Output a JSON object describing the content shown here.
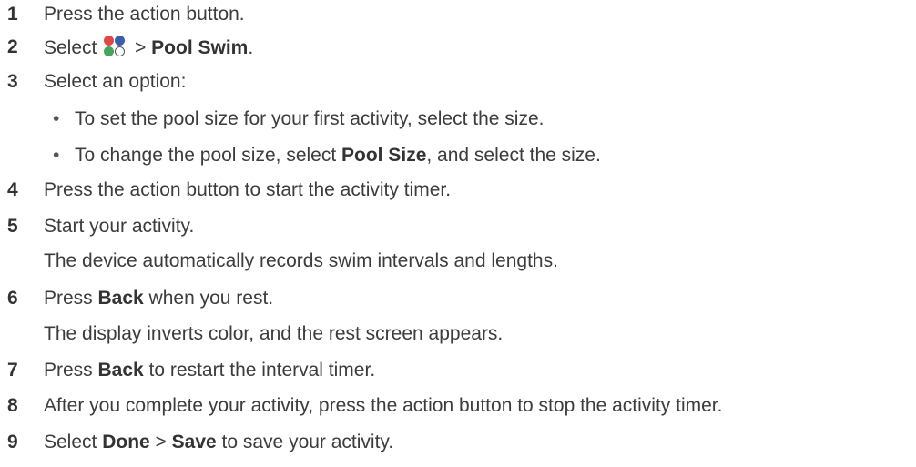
{
  "steps": [
    {
      "num": "1",
      "text": "Press the action button."
    },
    {
      "num": "2",
      "pre": "Select",
      "icon": "activity-colors-icon",
      "sep": " > ",
      "bold": "Pool Swim",
      "post": "."
    },
    {
      "num": "3",
      "text": "Select an option:"
    },
    {
      "num": "4",
      "text": "Press the action button to start the activity timer."
    },
    {
      "num": "5",
      "text": "Start your activity.",
      "cont": "The device automatically records swim intervals and lengths."
    },
    {
      "num": "6",
      "pre": "Press ",
      "bold": "Back",
      "post": " when you rest.",
      "cont": "The display inverts color, and the rest screen appears."
    },
    {
      "num": "7",
      "pre": "Press ",
      "bold": "Back",
      "post": " to restart the interval timer."
    },
    {
      "num": "8",
      "text": "After you complete your activity, press the action button to stop the activity timer."
    },
    {
      "num": "9",
      "pre": "Select ",
      "bold": "Done",
      "mid": " > ",
      "bold2": "Save",
      "post": " to save your activity."
    }
  ],
  "options": [
    {
      "bullet": "•",
      "text": "To set the pool size for your first activity, select the size."
    },
    {
      "bullet": "•",
      "pre": "To change the pool size, select ",
      "bold": "Pool Size",
      "post": ", and select the size."
    }
  ],
  "icon_colors": {
    "red": "#e04848",
    "blue": "#3a5fa8",
    "green": "#46a35a",
    "white": "#ffffff"
  }
}
